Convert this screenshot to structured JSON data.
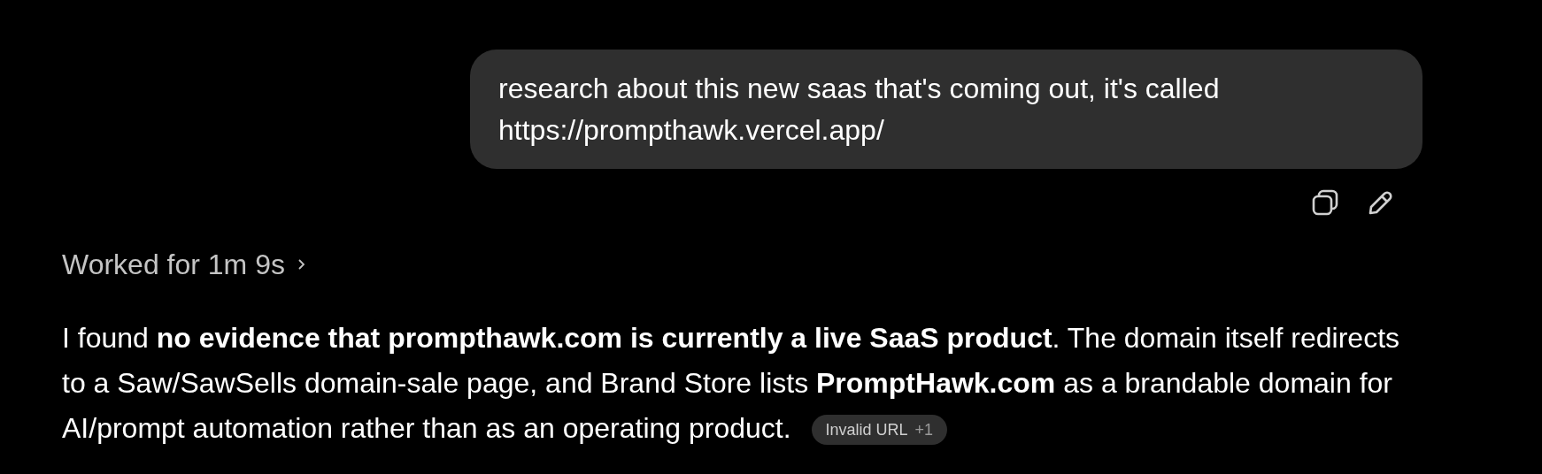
{
  "user_message": {
    "text": "research about this new saas that's coming out, it's called https://prompthawk.vercel.app/"
  },
  "message_actions": [
    {
      "kind": "copy"
    },
    {
      "kind": "edit"
    }
  ],
  "worked_for": {
    "text": "Worked for 1m 9s",
    "expanded": false
  },
  "response": {
    "text": "I found **no evidence that prompthawk.com is currently a live SaaS product**. The domain itself redirects to a Saw/SawSells domain-sale page, and Brand Store lists **PromptHawk.com** as a brandable domain for AI/prompt automation rather than as an operating product.",
    "citation": {
      "label": "Invalid URL",
      "count": "+1"
    }
  }
}
